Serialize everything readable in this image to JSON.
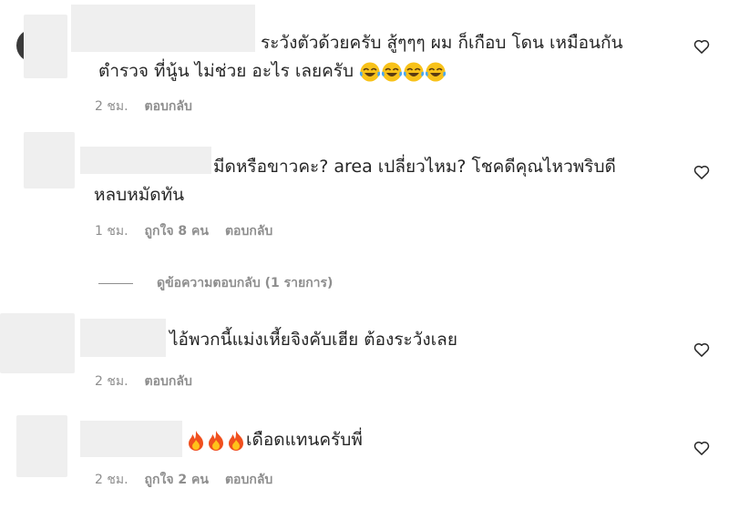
{
  "comments": [
    {
      "lines": [
        "ระวังตัวด้วยครับ สู้ๆๆๆ ผม ก็เกือบ โดน เหมือนกัน",
        "ตำรวจ ที่นู้น ไม่ช่วย อะไร เลยครับ"
      ],
      "trailing_emoji": "laughing-tears-emoji",
      "trailing_emoji_count": 4,
      "time": "2 ชม.",
      "likes": "",
      "reply": "ตอบกลับ"
    },
    {
      "lines": [
        "มีดหรือขาวคะ? area เปลี่ยวไหม? โชคดีคุณไหวพริบดี",
        "หลบหมัดทัน"
      ],
      "time": "1 ชม.",
      "likes": "ถูกใจ 8 คน",
      "reply": "ตอบกลับ"
    },
    {
      "lines": [
        "ไอ้พวกนี้แม่งเหี้ยจิงคับเฮีย ต้องระวังเลย"
      ],
      "time": "2 ชม.",
      "likes": "",
      "reply": "ตอบกลับ"
    },
    {
      "lines": [
        "เดือดแทนครับพี่"
      ],
      "leading_emoji": "fire-emoji",
      "leading_emoji_count": 3,
      "time": "2 ชม.",
      "likes": "ถูกใจ 2 คน",
      "reply": "ตอบกลับ"
    }
  ],
  "view_replies": "ดูข้อความตอบกลับ (1 รายการ)",
  "icons": {
    "like": "heart-outline-icon"
  },
  "colors": {
    "meta": "#8e8e8e",
    "text": "#262626",
    "redaction": "#efefef",
    "fire": "#f0501e",
    "laugh": "#f8c21a"
  }
}
